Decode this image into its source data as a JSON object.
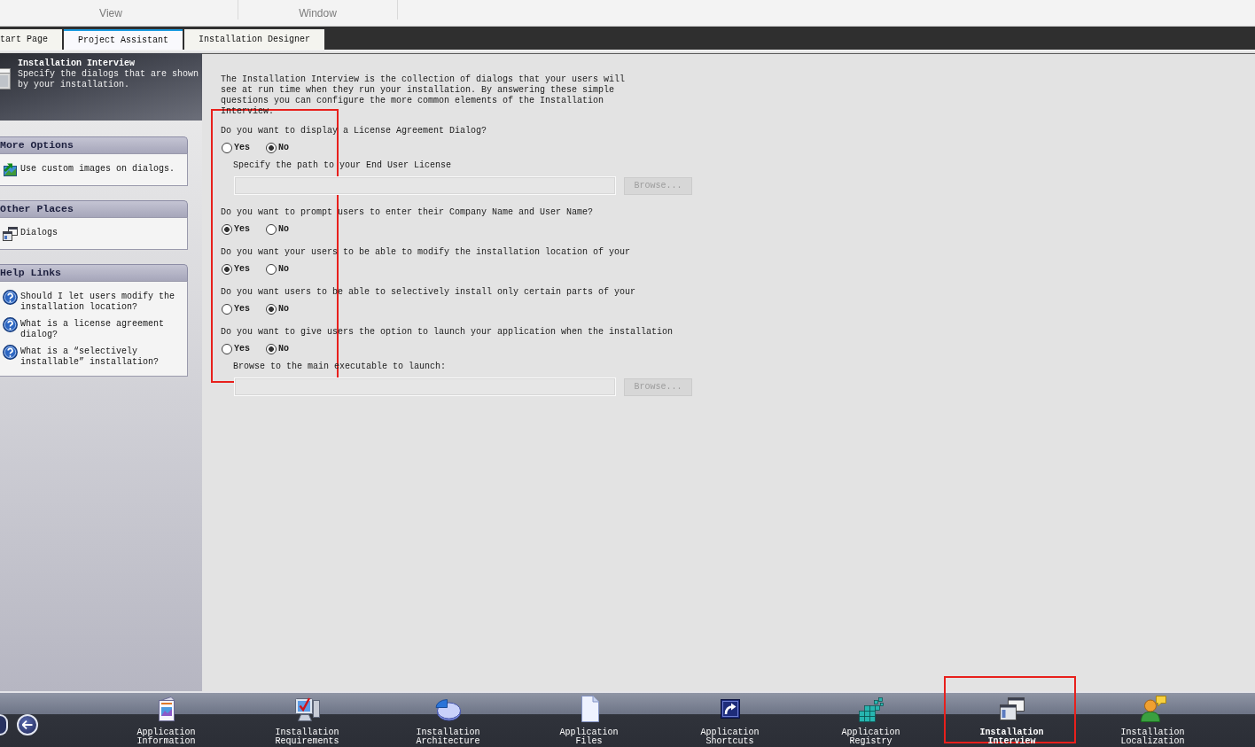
{
  "ribbon": {
    "groups": [
      {
        "label": "View"
      },
      {
        "label": "Window"
      }
    ]
  },
  "tabs": [
    {
      "label": "tart Page",
      "selected": false
    },
    {
      "label": "Project Assistant",
      "selected": true
    },
    {
      "label": "Installation Designer",
      "selected": false
    }
  ],
  "sidebar": {
    "header": {
      "title": "Installation Interview",
      "description": "Specify the dialogs that are shown by your installation."
    },
    "sections": [
      {
        "title": "More Options",
        "items": [
          {
            "kind": "image",
            "label": "Use custom images on dialogs."
          }
        ]
      },
      {
        "title": "Other Places",
        "items": [
          {
            "kind": "dialog",
            "label": "Dialogs"
          }
        ]
      },
      {
        "title": "Help Links",
        "items": [
          {
            "kind": "help",
            "label": "Should I let users modify the installation location?"
          },
          {
            "kind": "help",
            "label": "What is a license agreement dialog?"
          },
          {
            "kind": "help",
            "label": "What is a “selectively installable” installation?"
          }
        ]
      }
    ]
  },
  "content": {
    "intro": "The Installation Interview is the collection of dialogs that your users will see at run time when they run your installation. By answering these simple questions you can configure the more common elements of the Installation Interview.",
    "questions": [
      {
        "text": "Do you want to display a License Agreement Dialog?",
        "options": [
          {
            "label": "Yes",
            "selected": false
          },
          {
            "label": "No",
            "selected": true
          }
        ],
        "file_field": {
          "label": "Specify the path to your End User License",
          "browse_button": {
            "label": "Browse...",
            "disabled": true
          }
        }
      },
      {
        "text": "Do you want to prompt users to enter their Company Name and User Name?",
        "options": [
          {
            "label": "Yes",
            "selected": true
          },
          {
            "label": "No",
            "selected": false
          }
        ]
      },
      {
        "text": "Do you want your users to be able to modify the installation location of your",
        "options": [
          {
            "label": "Yes",
            "selected": true
          },
          {
            "label": "No",
            "selected": false
          }
        ]
      },
      {
        "text": "Do you want users to be able to selectively install only certain parts of your",
        "options": [
          {
            "label": "Yes",
            "selected": false
          },
          {
            "label": "No",
            "selected": true
          }
        ]
      },
      {
        "text": "Do you want to give users the option to launch your application when the installation",
        "options": [
          {
            "label": "Yes",
            "selected": false
          },
          {
            "label": "No",
            "selected": true
          }
        ],
        "file_field": {
          "label": "Browse to the main executable to launch:",
          "browse_button": {
            "label": "Browse...",
            "disabled": true
          }
        }
      }
    ]
  },
  "bottom_nav": {
    "items": [
      {
        "kind": "information",
        "label": "Application Information",
        "selected": false
      },
      {
        "kind": "requirements",
        "label": "Installation Requirements",
        "selected": false
      },
      {
        "kind": "architecture",
        "label": "Installation Architecture",
        "selected": false
      },
      {
        "kind": "files",
        "label": "Application Files",
        "selected": false
      },
      {
        "kind": "shortcuts",
        "label": "Application Shortcuts",
        "selected": false
      },
      {
        "kind": "registry",
        "label": "Application Registry",
        "selected": false
      },
      {
        "kind": "interview",
        "label": "Installation Interview",
        "selected": true
      },
      {
        "kind": "localization",
        "label": "Installation Localization",
        "selected": false
      }
    ]
  }
}
